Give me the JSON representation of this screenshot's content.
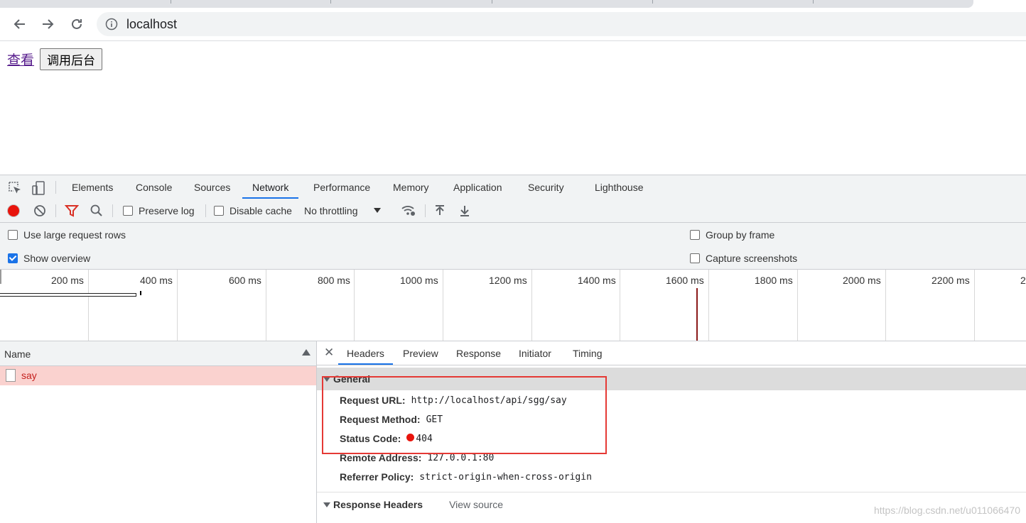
{
  "browser": {
    "url": "localhost",
    "back_icon": "arrow-left-icon",
    "forward_icon": "arrow-right-icon",
    "reload_icon": "reload-icon",
    "info_icon": "info-icon"
  },
  "page": {
    "link_label": "查看",
    "button_label": "调用后台"
  },
  "devtools": {
    "tabs": [
      "Elements",
      "Console",
      "Sources",
      "Network",
      "Performance",
      "Memory",
      "Application",
      "Security",
      "Lighthouse"
    ],
    "active_tab": "Network",
    "toolbar": {
      "preserve_log": "Preserve log",
      "disable_cache": "Disable cache",
      "throttling": "No throttling"
    },
    "settings": {
      "large_rows": "Use large request rows",
      "show_overview": "Show overview",
      "group_by_frame": "Group by frame",
      "capture_screenshots": "Capture screenshots"
    },
    "overview_ticks": [
      "200 ms",
      "400 ms",
      "600 ms",
      "800 ms",
      "1000 ms",
      "1200 ms",
      "1400 ms",
      "1600 ms",
      "1800 ms",
      "2000 ms",
      "2200 ms",
      "2"
    ],
    "requests": {
      "column_name": "Name",
      "rows": [
        "say"
      ]
    },
    "details": {
      "tabs": [
        "Headers",
        "Preview",
        "Response",
        "Initiator",
        "Timing"
      ],
      "active_tab": "Headers",
      "general_title": "General",
      "fields": [
        {
          "key": "Request URL:",
          "value": "http://localhost/api/sgg/say"
        },
        {
          "key": "Request Method:",
          "value": "GET"
        },
        {
          "key": "Status Code:",
          "value": "404"
        },
        {
          "key": "Remote Address:",
          "value": "127.0.0.1:80"
        },
        {
          "key": "Referrer Policy:",
          "value": "strict-origin-when-cross-origin"
        }
      ],
      "response_headers_title": "Response Headers",
      "view_source": "View source"
    }
  },
  "watermark": "https://blog.csdn.net/u011066470",
  "colors": {
    "accent": "#1a73e8",
    "error_row": "#fad2cf",
    "error_text": "#c5221f",
    "record": "#e8140c",
    "highlight": "#e53935"
  }
}
